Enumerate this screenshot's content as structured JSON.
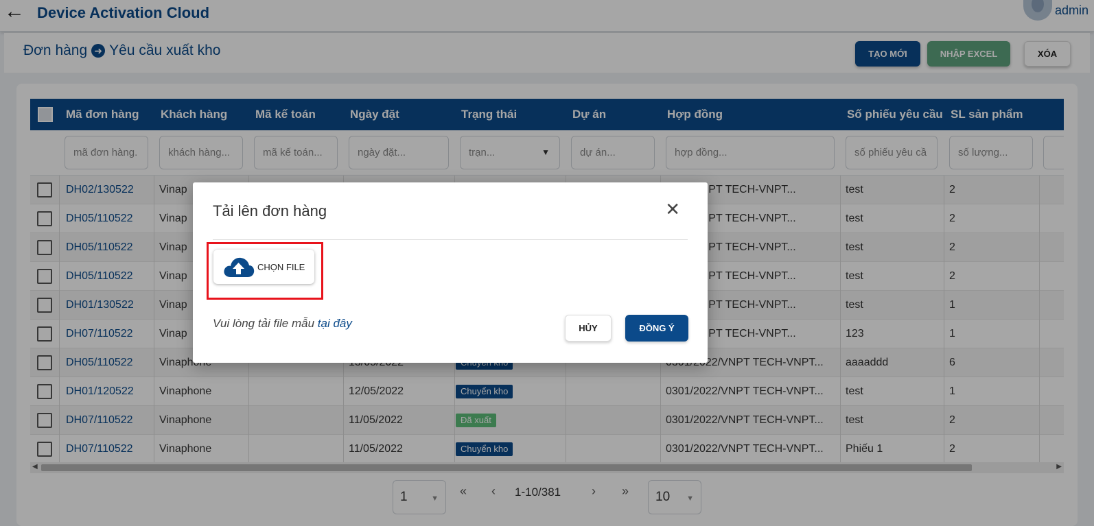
{
  "app": {
    "title": "Device Activation Cloud",
    "user_name": "admin"
  },
  "breadcrumb": {
    "parent": "Đơn hàng",
    "current": "Yêu cầu xuất kho"
  },
  "toolbar": {
    "create_label": "TẠO MỚI",
    "import_label": "NHẬP EXCEL",
    "delete_label": "XÓA"
  },
  "table": {
    "headers": [
      "Mã đơn hàng",
      "Khách hàng",
      "Mã kế toán",
      "Ngày đặt",
      "Trạng thái",
      "Dự án",
      "Hợp đồng",
      "Số phiếu yêu cầu",
      "SL sản phẩm"
    ],
    "filters": [
      "mã đơn hàng.",
      "khách hàng...",
      "mã kế toán...",
      "ngày đặt...",
      "trạn...",
      "dự án...",
      "hợp đồng...",
      "số phiếu yêu cầ",
      "số lượng..."
    ],
    "rows": [
      {
        "code": "DH02/130522",
        "customer": "Vinap",
        "date": "",
        "status": "",
        "contract": "2022/VNPT TECH-VNPT...",
        "request": "test",
        "qty": "2"
      },
      {
        "code": "DH05/110522",
        "customer": "Vinap",
        "date": "",
        "status": "",
        "contract": "2022/VNPT TECH-VNPT...",
        "request": "test",
        "qty": "2"
      },
      {
        "code": "DH05/110522",
        "customer": "Vinap",
        "date": "",
        "status": "",
        "contract": "2022/VNPT TECH-VNPT...",
        "request": "test",
        "qty": "2"
      },
      {
        "code": "DH05/110522",
        "customer": "Vinap",
        "date": "",
        "status": "",
        "contract": "2022/VNPT TECH-VNPT...",
        "request": "test",
        "qty": "2"
      },
      {
        "code": "DH01/130522",
        "customer": "Vinap",
        "date": "",
        "status": "",
        "contract": "2022/VNPT TECH-VNPT...",
        "request": "test",
        "qty": "1"
      },
      {
        "code": "DH07/110522",
        "customer": "Vinap",
        "date": "",
        "status": "",
        "contract": "2022/VNPT TECH-VNPT...",
        "request": "123",
        "qty": "1"
      },
      {
        "code": "DH05/110522",
        "customer": "Vinaphone",
        "date": "13/05/2022",
        "status": "Chuyển kho",
        "contract": "0301/2022/VNPT TECH-VNPT...",
        "request": "aaaaddd",
        "qty": "6"
      },
      {
        "code": "DH01/120522",
        "customer": "Vinaphone",
        "date": "12/05/2022",
        "status": "Chuyển kho",
        "contract": "0301/2022/VNPT TECH-VNPT...",
        "request": "test",
        "qty": "1"
      },
      {
        "code": "DH07/110522",
        "customer": "Vinaphone",
        "date": "11/05/2022",
        "status": "Đã xuất",
        "contract": "0301/2022/VNPT TECH-VNPT...",
        "request": "test",
        "qty": "2"
      },
      {
        "code": "DH07/110522",
        "customer": "Vinaphone",
        "date": "11/05/2022",
        "status": "Chuyển kho",
        "contract": "0301/2022/VNPT TECH-VNPT...",
        "request": "Phiếu 1",
        "qty": "2"
      }
    ]
  },
  "status_colors": {
    "Chuyển kho": "#0b4a8a",
    "Đã xuất": "#5cbd7a"
  },
  "pagination": {
    "page": "1",
    "range": "1-10/381",
    "page_size": "10"
  },
  "modal": {
    "title": "Tải lên đơn hàng",
    "choose_file_label": "CHỌN FILE",
    "template_text": "Vui lòng tải file mẫu",
    "template_link": "tại đây",
    "cancel_label": "HỦY",
    "ok_label": "ĐỒNG Ý"
  }
}
